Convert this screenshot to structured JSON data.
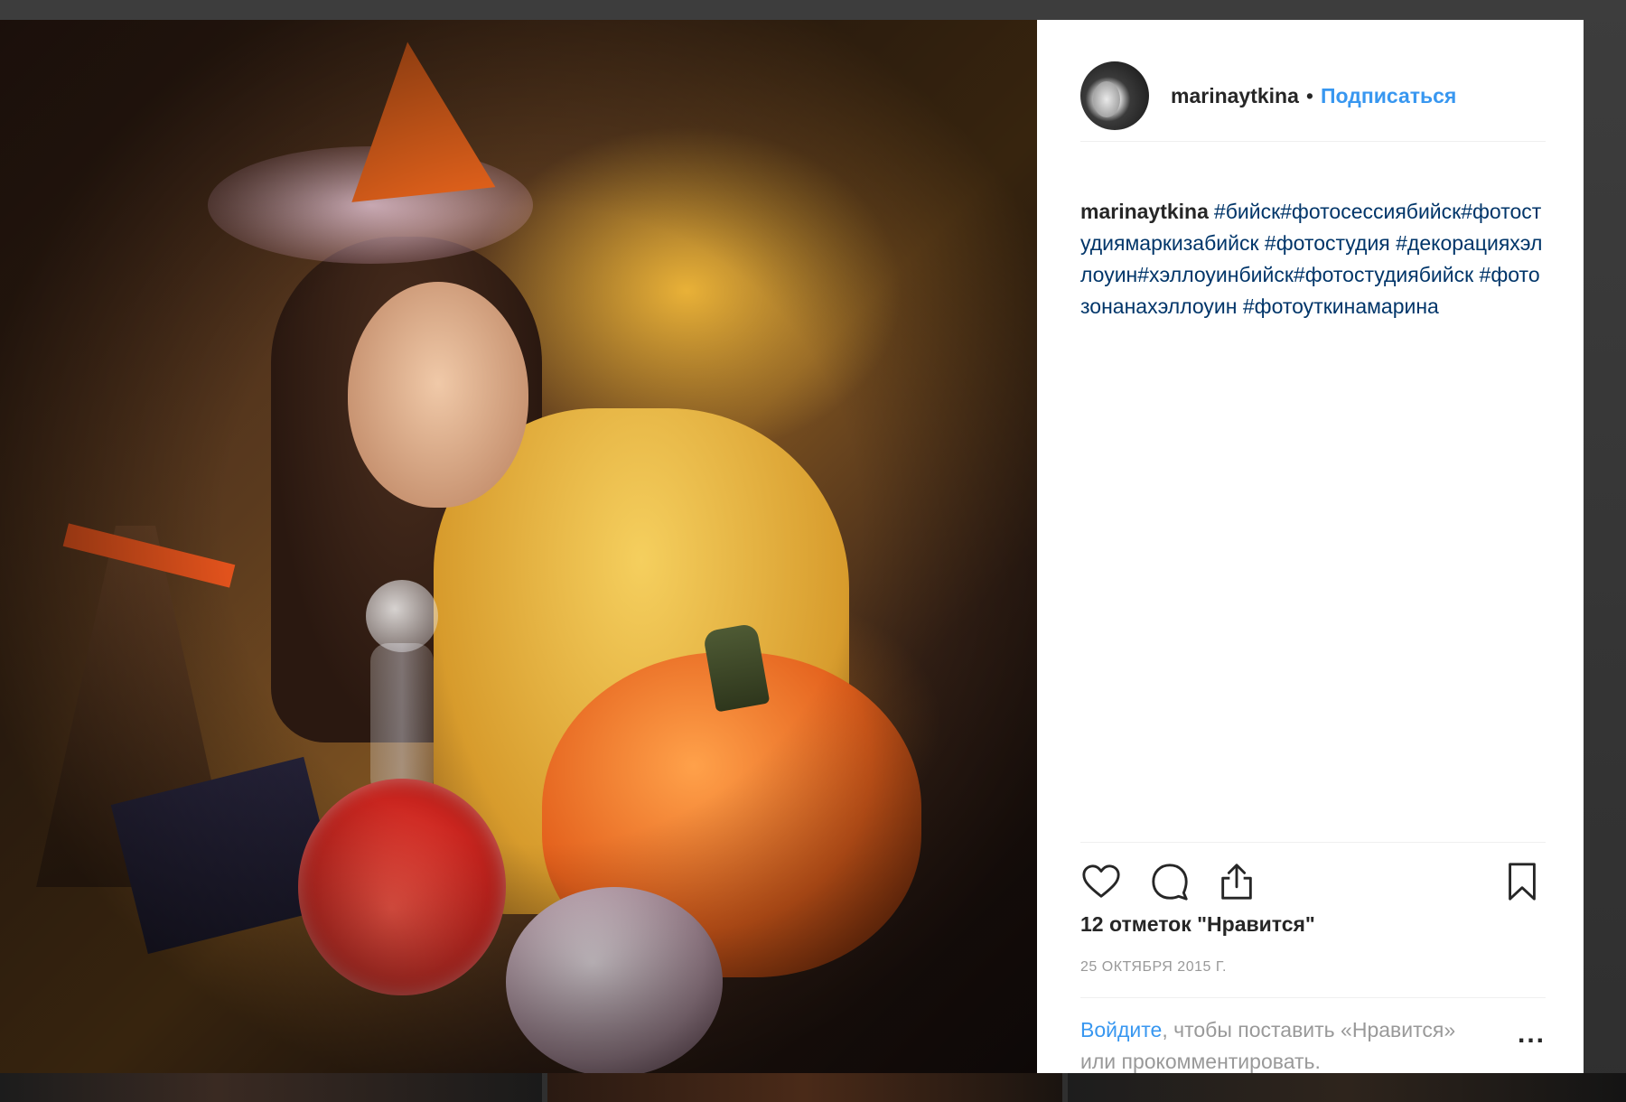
{
  "post": {
    "username": "marinaytkina",
    "dot": "•",
    "follow_label": "Подписаться",
    "caption_tags": "#бийск#фотосессиябийск#фотостудиямаркизабийск #фотостудия #декорацияхэллоуин#хэллоуинбийск#фотостудиябийск #фотозонанахэллоуин #фотоуткинамарина",
    "likes": "12 отметок \"Нравится\"",
    "date": "25 ОКТЯБРЯ 2015 Г.",
    "login_link": "Войдите",
    "login_rest": ", чтобы поставить «Нравится» или прокомментировать.",
    "more": "..."
  },
  "icons": {
    "like": "heart-icon",
    "comment": "comment-icon",
    "share": "share-icon",
    "save": "bookmark-icon",
    "more": "more-options-icon"
  },
  "colors": {
    "link": "#3897f0",
    "hashtag": "#003569",
    "text": "#262626",
    "muted": "#999999",
    "backdrop": "#3a3a3a"
  }
}
